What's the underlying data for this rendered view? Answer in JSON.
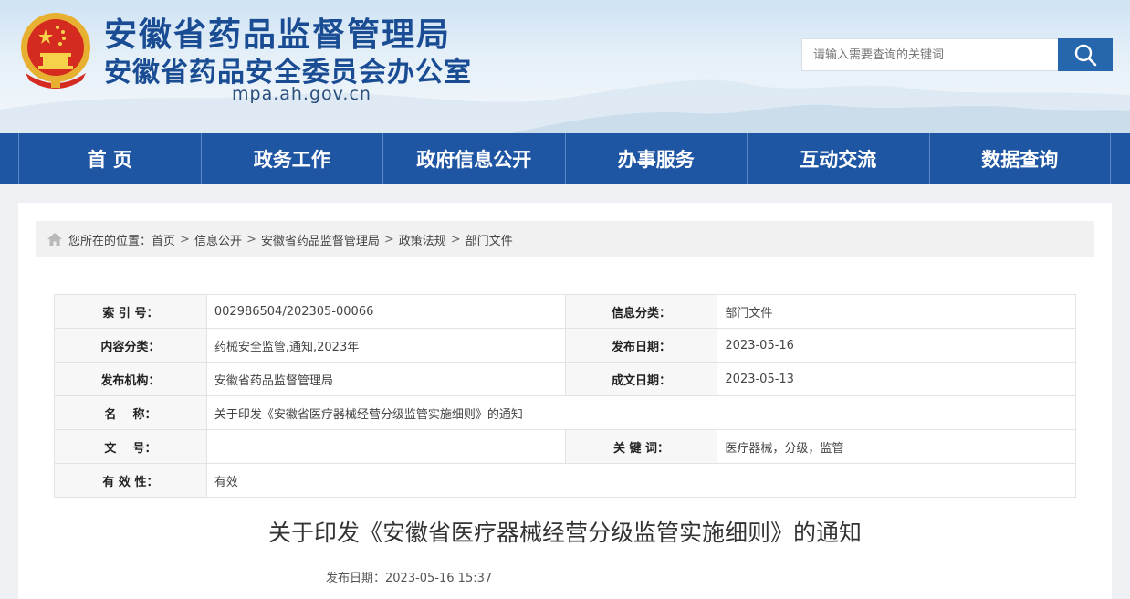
{
  "header": {
    "title_main": "安徽省药品监督管理局",
    "title_sub": "安徽省药品安全委员会办公室",
    "domain": "mpa.ah.gov.cn",
    "search": {
      "placeholder": "请输入需要查询的关键词",
      "icon": "search-icon"
    },
    "colors": {
      "title": "#1a4c94",
      "nav_bg": "#1f56a3",
      "search_btn": "#2566ad"
    }
  },
  "nav": {
    "items": [
      "首 页",
      "政务工作",
      "政府信息公开",
      "办事服务",
      "互动交流",
      "数据查询"
    ]
  },
  "breadcrumb": {
    "prefix": "您所在的位置：",
    "items": [
      "首页",
      "信息公开",
      "安徽省药品监督管理局",
      "政策法规",
      "部门文件"
    ],
    "separator": ">"
  },
  "meta": {
    "index_label": "索 引 号：",
    "index_value": "002986504/202305-00066",
    "category_label": "信息分类：",
    "category_value": "部门文件",
    "content_type_label": "内容分类：",
    "content_type_value": "药械安全监管,通知,2023年",
    "publish_date_label": "发布日期：",
    "publish_date_value": "2023-05-16",
    "publisher_label": "发布机构：",
    "publisher_value": "安徽省药品监督管理局",
    "created_date_label": "成文日期：",
    "created_date_value": "2023-05-13",
    "name_label": "名    称：",
    "name_value": "关于印发《安徽省医疗器械经营分级监管实施细则》的通知",
    "doc_no_label": "文    号：",
    "doc_no_value": "",
    "keywords_label": "关 键 词：",
    "keywords_value": "医疗器械，分级，监管",
    "validity_label": "有 效 性：",
    "validity_value": "有效"
  },
  "article": {
    "title": "关于印发《安徽省医疗器械经营分级监管实施细则》的通知",
    "publish_info": "发布日期：2023-05-16 15:37"
  }
}
